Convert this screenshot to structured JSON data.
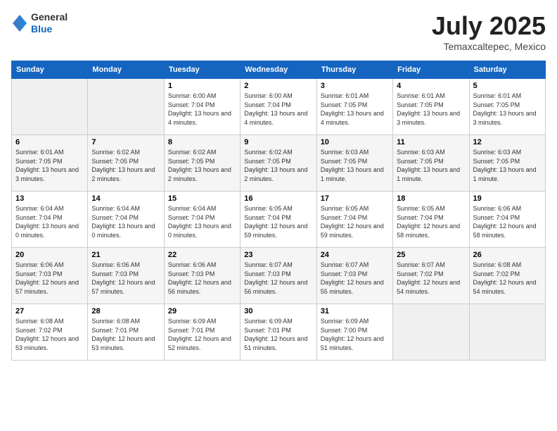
{
  "header": {
    "logo_general": "General",
    "logo_blue": "Blue",
    "title": "July 2025",
    "location": "Temaxcaltepec, Mexico"
  },
  "weekdays": [
    "Sunday",
    "Monday",
    "Tuesday",
    "Wednesday",
    "Thursday",
    "Friday",
    "Saturday"
  ],
  "weeks": [
    [
      {
        "day": "",
        "empty": true
      },
      {
        "day": "",
        "empty": true
      },
      {
        "day": "1",
        "sunrise": "Sunrise: 6:00 AM",
        "sunset": "Sunset: 7:04 PM",
        "daylight": "Daylight: 13 hours and 4 minutes."
      },
      {
        "day": "2",
        "sunrise": "Sunrise: 6:00 AM",
        "sunset": "Sunset: 7:04 PM",
        "daylight": "Daylight: 13 hours and 4 minutes."
      },
      {
        "day": "3",
        "sunrise": "Sunrise: 6:01 AM",
        "sunset": "Sunset: 7:05 PM",
        "daylight": "Daylight: 13 hours and 4 minutes."
      },
      {
        "day": "4",
        "sunrise": "Sunrise: 6:01 AM",
        "sunset": "Sunset: 7:05 PM",
        "daylight": "Daylight: 13 hours and 3 minutes."
      },
      {
        "day": "5",
        "sunrise": "Sunrise: 6:01 AM",
        "sunset": "Sunset: 7:05 PM",
        "daylight": "Daylight: 13 hours and 3 minutes."
      }
    ],
    [
      {
        "day": "6",
        "sunrise": "Sunrise: 6:01 AM",
        "sunset": "Sunset: 7:05 PM",
        "daylight": "Daylight: 13 hours and 3 minutes."
      },
      {
        "day": "7",
        "sunrise": "Sunrise: 6:02 AM",
        "sunset": "Sunset: 7:05 PM",
        "daylight": "Daylight: 13 hours and 2 minutes."
      },
      {
        "day": "8",
        "sunrise": "Sunrise: 6:02 AM",
        "sunset": "Sunset: 7:05 PM",
        "daylight": "Daylight: 13 hours and 2 minutes."
      },
      {
        "day": "9",
        "sunrise": "Sunrise: 6:02 AM",
        "sunset": "Sunset: 7:05 PM",
        "daylight": "Daylight: 13 hours and 2 minutes."
      },
      {
        "day": "10",
        "sunrise": "Sunrise: 6:03 AM",
        "sunset": "Sunset: 7:05 PM",
        "daylight": "Daylight: 13 hours and 1 minute."
      },
      {
        "day": "11",
        "sunrise": "Sunrise: 6:03 AM",
        "sunset": "Sunset: 7:05 PM",
        "daylight": "Daylight: 13 hours and 1 minute."
      },
      {
        "day": "12",
        "sunrise": "Sunrise: 6:03 AM",
        "sunset": "Sunset: 7:05 PM",
        "daylight": "Daylight: 13 hours and 1 minute."
      }
    ],
    [
      {
        "day": "13",
        "sunrise": "Sunrise: 6:04 AM",
        "sunset": "Sunset: 7:04 PM",
        "daylight": "Daylight: 13 hours and 0 minutes."
      },
      {
        "day": "14",
        "sunrise": "Sunrise: 6:04 AM",
        "sunset": "Sunset: 7:04 PM",
        "daylight": "Daylight: 13 hours and 0 minutes."
      },
      {
        "day": "15",
        "sunrise": "Sunrise: 6:04 AM",
        "sunset": "Sunset: 7:04 PM",
        "daylight": "Daylight: 13 hours and 0 minutes."
      },
      {
        "day": "16",
        "sunrise": "Sunrise: 6:05 AM",
        "sunset": "Sunset: 7:04 PM",
        "daylight": "Daylight: 12 hours and 59 minutes."
      },
      {
        "day": "17",
        "sunrise": "Sunrise: 6:05 AM",
        "sunset": "Sunset: 7:04 PM",
        "daylight": "Daylight: 12 hours and 59 minutes."
      },
      {
        "day": "18",
        "sunrise": "Sunrise: 6:05 AM",
        "sunset": "Sunset: 7:04 PM",
        "daylight": "Daylight: 12 hours and 58 minutes."
      },
      {
        "day": "19",
        "sunrise": "Sunrise: 6:06 AM",
        "sunset": "Sunset: 7:04 PM",
        "daylight": "Daylight: 12 hours and 58 minutes."
      }
    ],
    [
      {
        "day": "20",
        "sunrise": "Sunrise: 6:06 AM",
        "sunset": "Sunset: 7:03 PM",
        "daylight": "Daylight: 12 hours and 57 minutes."
      },
      {
        "day": "21",
        "sunrise": "Sunrise: 6:06 AM",
        "sunset": "Sunset: 7:03 PM",
        "daylight": "Daylight: 12 hours and 57 minutes."
      },
      {
        "day": "22",
        "sunrise": "Sunrise: 6:06 AM",
        "sunset": "Sunset: 7:03 PM",
        "daylight": "Daylight: 12 hours and 56 minutes."
      },
      {
        "day": "23",
        "sunrise": "Sunrise: 6:07 AM",
        "sunset": "Sunset: 7:03 PM",
        "daylight": "Daylight: 12 hours and 56 minutes."
      },
      {
        "day": "24",
        "sunrise": "Sunrise: 6:07 AM",
        "sunset": "Sunset: 7:03 PM",
        "daylight": "Daylight: 12 hours and 55 minutes."
      },
      {
        "day": "25",
        "sunrise": "Sunrise: 6:07 AM",
        "sunset": "Sunset: 7:02 PM",
        "daylight": "Daylight: 12 hours and 54 minutes."
      },
      {
        "day": "26",
        "sunrise": "Sunrise: 6:08 AM",
        "sunset": "Sunset: 7:02 PM",
        "daylight": "Daylight: 12 hours and 54 minutes."
      }
    ],
    [
      {
        "day": "27",
        "sunrise": "Sunrise: 6:08 AM",
        "sunset": "Sunset: 7:02 PM",
        "daylight": "Daylight: 12 hours and 53 minutes."
      },
      {
        "day": "28",
        "sunrise": "Sunrise: 6:08 AM",
        "sunset": "Sunset: 7:01 PM",
        "daylight": "Daylight: 12 hours and 53 minutes."
      },
      {
        "day": "29",
        "sunrise": "Sunrise: 6:09 AM",
        "sunset": "Sunset: 7:01 PM",
        "daylight": "Daylight: 12 hours and 52 minutes."
      },
      {
        "day": "30",
        "sunrise": "Sunrise: 6:09 AM",
        "sunset": "Sunset: 7:01 PM",
        "daylight": "Daylight: 12 hours and 51 minutes."
      },
      {
        "day": "31",
        "sunrise": "Sunrise: 6:09 AM",
        "sunset": "Sunset: 7:00 PM",
        "daylight": "Daylight: 12 hours and 51 minutes."
      },
      {
        "day": "",
        "empty": true
      },
      {
        "day": "",
        "empty": true
      }
    ]
  ]
}
